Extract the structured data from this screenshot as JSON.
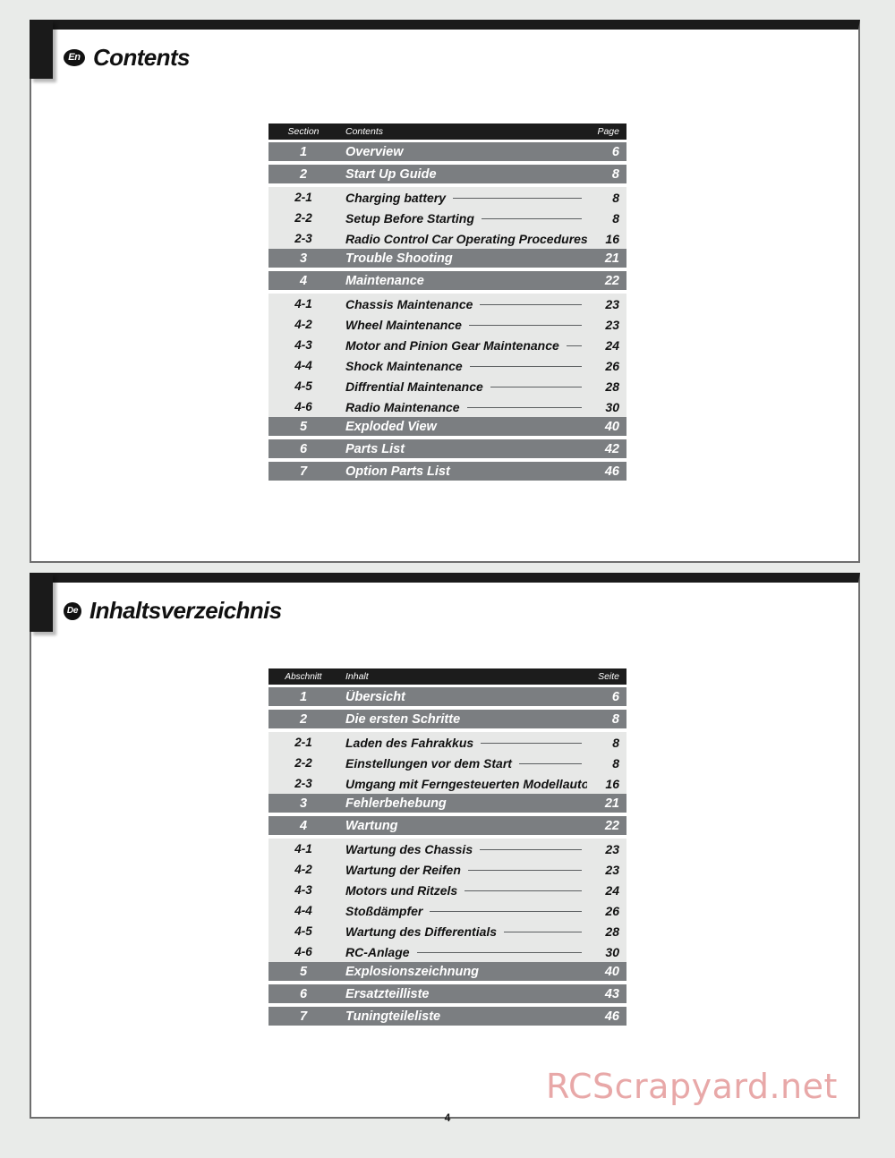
{
  "document": {
    "page_number": "4",
    "watermark": "RCScrapyard.net",
    "colors": {
      "page_background": "#e9ebe9",
      "paper": "#ffffff",
      "header_row": "#1c1c1c",
      "major_row": "#7b7e81",
      "minor_row": "#e7e8e7",
      "leader_line": "#5b5e60",
      "watermark": "#e8a8a8"
    }
  },
  "sections": [
    {
      "lang_badge": "En",
      "title": "Contents",
      "table": {
        "headers": {
          "section": "Section",
          "contents": "Contents",
          "page": "Page"
        },
        "rows": [
          {
            "type": "major",
            "section": "1",
            "label": "Overview",
            "page": "6"
          },
          {
            "type": "major",
            "section": "2",
            "label": "Start Up Guide",
            "page": "8"
          },
          {
            "type": "minor",
            "section": "2-1",
            "label": "Charging battery",
            "page": "8"
          },
          {
            "type": "minor",
            "section": "2-2",
            "label": "Setup Before Starting",
            "page": "8"
          },
          {
            "type": "minor",
            "section": "2-3",
            "label": "Radio Control Car Operating Procedures",
            "page": "16"
          },
          {
            "type": "major",
            "section": "3",
            "label": "Trouble Shooting",
            "page": "21"
          },
          {
            "type": "major",
            "section": "4",
            "label": "Maintenance",
            "page": "22"
          },
          {
            "type": "minor",
            "section": "4-1",
            "label": "Chassis Maintenance",
            "page": "23"
          },
          {
            "type": "minor",
            "section": "4-2",
            "label": "Wheel Maintenance",
            "page": "23"
          },
          {
            "type": "minor",
            "section": "4-3",
            "label": "Motor and Pinion Gear Maintenance",
            "page": "24"
          },
          {
            "type": "minor",
            "section": "4-4",
            "label": "Shock Maintenance",
            "page": "26"
          },
          {
            "type": "minor",
            "section": "4-5",
            "label": "Diffrential Maintenance",
            "page": "28"
          },
          {
            "type": "minor",
            "section": "4-6",
            "label": "Radio Maintenance",
            "page": "30"
          },
          {
            "type": "major",
            "section": "5",
            "label": "Exploded View",
            "page": "40"
          },
          {
            "type": "major",
            "section": "6",
            "label": "Parts List",
            "page": "42"
          },
          {
            "type": "major",
            "section": "7",
            "label": "Option Parts List",
            "page": "46"
          }
        ]
      }
    },
    {
      "lang_badge": "De",
      "title": "Inhaltsverzeichnis",
      "table": {
        "headers": {
          "section": "Abschnitt",
          "contents": "Inhalt",
          "page": "Seite"
        },
        "rows": [
          {
            "type": "major",
            "section": "1",
            "label": "Übersicht",
            "page": "6"
          },
          {
            "type": "major",
            "section": "2",
            "label": "Die ersten Schritte",
            "page": "8"
          },
          {
            "type": "minor",
            "section": "2-1",
            "label": "Laden des Fahrakkus",
            "page": "8"
          },
          {
            "type": "minor",
            "section": "2-2",
            "label": "Einstellungen vor dem Start",
            "page": "8"
          },
          {
            "type": "minor",
            "section": "2-3",
            "label": "Umgang mit Ferngesteuerten Modellautos",
            "page": "16"
          },
          {
            "type": "major",
            "section": "3",
            "label": "Fehlerbehebung",
            "page": "21"
          },
          {
            "type": "major",
            "section": "4",
            "label": "Wartung",
            "page": "22"
          },
          {
            "type": "minor",
            "section": "4-1",
            "label": "Wartung des Chassis",
            "page": "23"
          },
          {
            "type": "minor",
            "section": "4-2",
            "label": "Wartung der Reifen",
            "page": "23"
          },
          {
            "type": "minor",
            "section": "4-3",
            "label": "Motors und Ritzels",
            "page": "24"
          },
          {
            "type": "minor",
            "section": "4-4",
            "label": "Stoßdämpfer",
            "page": "26"
          },
          {
            "type": "minor",
            "section": "4-5",
            "label": "Wartung des Differentials",
            "page": "28"
          },
          {
            "type": "minor",
            "section": "4-6",
            "label": "RC-Anlage",
            "page": "30"
          },
          {
            "type": "major",
            "section": "5",
            "label": "Explosionszeichnung",
            "page": "40"
          },
          {
            "type": "major",
            "section": "6",
            "label": "Ersatzteilliste",
            "page": "43"
          },
          {
            "type": "major",
            "section": "7",
            "label": "Tuningteileliste",
            "page": "46"
          }
        ]
      }
    }
  ]
}
